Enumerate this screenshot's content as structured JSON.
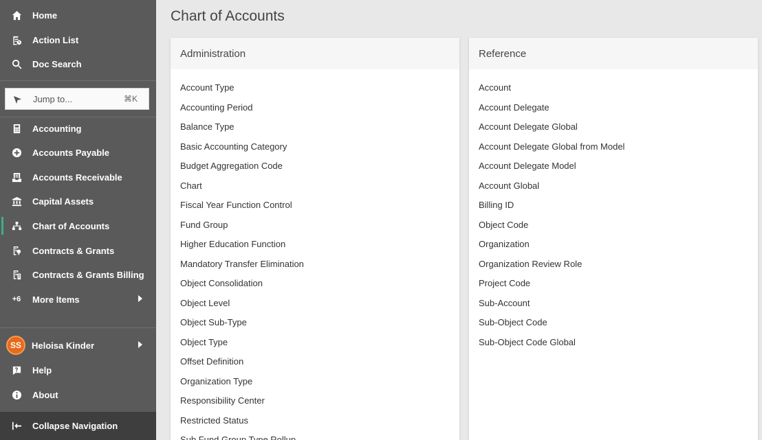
{
  "sidebar": {
    "top_items": [
      {
        "label": "Home",
        "icon": "home-icon"
      },
      {
        "label": "Action List",
        "icon": "action-list-icon"
      },
      {
        "label": "Doc Search",
        "icon": "search-icon"
      }
    ],
    "jump": {
      "label": "Jump to...",
      "shortcut": "⌘K",
      "icon": "compass-icon"
    },
    "modules": [
      {
        "label": "Accounting",
        "icon": "calculator-icon"
      },
      {
        "label": "Accounts Payable",
        "icon": "payable-icon"
      },
      {
        "label": "Accounts Receivable",
        "icon": "receivable-icon"
      },
      {
        "label": "Capital Assets",
        "icon": "bank-icon"
      },
      {
        "label": "Chart of Accounts",
        "icon": "org-chart-icon",
        "active": true
      },
      {
        "label": "Contracts & Grants",
        "icon": "grant-icon"
      },
      {
        "label": "Contracts & Grants Billing",
        "icon": "grant-billing-icon"
      }
    ],
    "more": {
      "label": "More Items",
      "badge": "+6"
    },
    "user": {
      "initials": "SS",
      "name": "Heloisa Kinder"
    },
    "help": {
      "label": "Help"
    },
    "about": {
      "label": "About"
    },
    "collapse": {
      "label": "Collapse Navigation"
    }
  },
  "main": {
    "title": "Chart of Accounts",
    "administration": {
      "title": "Administration",
      "items": [
        "Account Type",
        "Accounting Period",
        "Balance Type",
        "Basic Accounting Category",
        "Budget Aggregation Code",
        "Chart",
        "Fiscal Year Function Control",
        "Fund Group",
        "Higher Education Function",
        "Mandatory Transfer Elimination",
        "Object Consolidation",
        "Object Level",
        "Object Sub-Type",
        "Object Type",
        "Offset Definition",
        "Organization Type",
        "Responsibility Center",
        "Restricted Status",
        "Sub Fund Group Type Rollup"
      ]
    },
    "reference": {
      "title": "Reference",
      "items": [
        "Account",
        "Account Delegate",
        "Account Delegate Global",
        "Account Delegate Global from Model",
        "Account Delegate Model",
        "Account Global",
        "Billing ID",
        "Object Code",
        "Organization",
        "Organization Review Role",
        "Project Code",
        "Sub-Account",
        "Sub-Object Code",
        "Sub-Object Code Global"
      ]
    }
  },
  "colors": {
    "sidebar": "#5a5a5a",
    "active_marker": "#3fae87",
    "avatar": "#e86a1a",
    "collapse_bar": "#3e3e3e"
  }
}
